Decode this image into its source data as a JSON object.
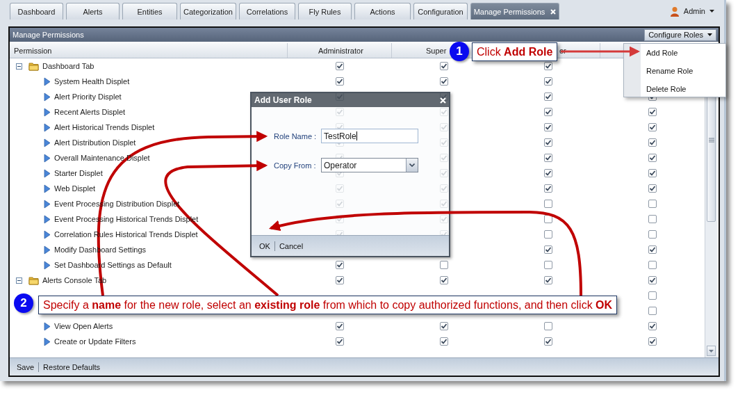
{
  "tabs": [
    {
      "label": "Dashboard",
      "selected": false
    },
    {
      "label": "Alerts",
      "selected": false
    },
    {
      "label": "Entities",
      "selected": false
    },
    {
      "label": "Categorization",
      "selected": false
    },
    {
      "label": "Correlations",
      "selected": false
    },
    {
      "label": "Fly Rules",
      "selected": false
    },
    {
      "label": "Actions",
      "selected": false
    },
    {
      "label": "Configuration",
      "selected": false
    },
    {
      "label": "Manage Permissions",
      "selected": true
    }
  ],
  "user": {
    "name": "Admin"
  },
  "panel": {
    "title": "Manage Permissions",
    "configure_button": "Configure Roles"
  },
  "columns": [
    "Permission",
    "Administrator",
    "Super",
    "or"
  ],
  "tree": [
    {
      "label": "Dashboard Tab",
      "expanded": true,
      "checks": {
        "column_2": true,
        "column_3": true,
        "column_4": true
      },
      "children": [
        {
          "label": "System Health Displet",
          "checks": {
            "column_2": true,
            "column_3": true,
            "column_4": true
          }
        },
        {
          "label": "Alert Priority Displet",
          "checks": {
            "column_2": true,
            "column_3": true,
            "column_4": true,
            "column_5": true
          }
        },
        {
          "label": "Recent Alerts Displet",
          "checks": {
            "column_2": true,
            "column_3": true,
            "column_4": true,
            "column_5": true
          }
        },
        {
          "label": "Alert Historical Trends Displet",
          "checks": {
            "column_2": true,
            "column_3": true,
            "column_4": true,
            "column_5": true
          }
        },
        {
          "label": "Alert Distribution Displet",
          "checks": {
            "column_2": true,
            "column_3": true,
            "column_4": true,
            "column_5": true
          }
        },
        {
          "label": "Overall Maintenance Displet",
          "checks": {
            "column_2": true,
            "column_3": true,
            "column_4": true,
            "column_5": true
          }
        },
        {
          "label": "Starter Displet",
          "checks": {
            "column_2": true,
            "column_3": true,
            "column_4": true,
            "column_5": true
          }
        },
        {
          "label": "Web Displet",
          "checks": {
            "column_2": true,
            "column_3": true,
            "column_4": true,
            "column_5": true
          }
        },
        {
          "label": "Event Processing Distribution Displet",
          "checks": {
            "column_2": true,
            "column_3": true,
            "column_4": false,
            "column_5": false
          }
        },
        {
          "label": "Event Processing Historical Trends Displet",
          "checks": {
            "column_2": true,
            "column_3": true,
            "column_4": false,
            "column_5": false
          }
        },
        {
          "label": "Correlation Rules Historical Trends Displet",
          "checks": {
            "column_2": true,
            "column_3": true,
            "column_4": false,
            "column_5": false
          }
        },
        {
          "label": "Modify Dashboard Settings",
          "checks": {
            "column_4": true,
            "column_5": true
          }
        },
        {
          "label": "Set Dashboard Settings as Default",
          "checks": {
            "column_2": true,
            "column_3": false,
            "column_4": false,
            "column_5": false
          }
        }
      ]
    },
    {
      "label": "Alerts Console Tab",
      "expanded": true,
      "checks": {
        "column_2": true,
        "column_3": true,
        "column_4": true,
        "column_5": true
      },
      "children": [
        {
          "checks": {
            "column_5": false
          }
        },
        {
          "checks": {
            "column_5": false
          }
        },
        {
          "label": "View Open Alerts",
          "checks": {
            "column_2": true,
            "column_3": true,
            "column_4": false,
            "column_5": true
          }
        },
        {
          "label": "Create or Update Filters",
          "checks": {
            "column_2": true,
            "column_3": true,
            "column_4": true,
            "column_5": true
          }
        }
      ]
    }
  ],
  "footer_buttons": [
    "Save",
    "Restore Defaults"
  ],
  "menu": [
    {
      "label": "Add Role"
    },
    {
      "label": "Rename Role"
    },
    {
      "label": "Delete Role"
    }
  ],
  "dialog": {
    "title": "Add User Role",
    "fields": [
      {
        "kind": "text",
        "label": "Role Name :",
        "value": "TestRole"
      },
      {
        "kind": "select",
        "label": "Copy From :",
        "value": "Operator"
      }
    ],
    "buttons": [
      "OK",
      "Cancel"
    ]
  },
  "callouts": [
    {
      "number": "1",
      "text": "Click **Add Role**"
    },
    {
      "number": "2",
      "text": "Specify a **name** for the new role, select an **existing role** from which to copy authorized functions, and then click **OK**"
    }
  ]
}
